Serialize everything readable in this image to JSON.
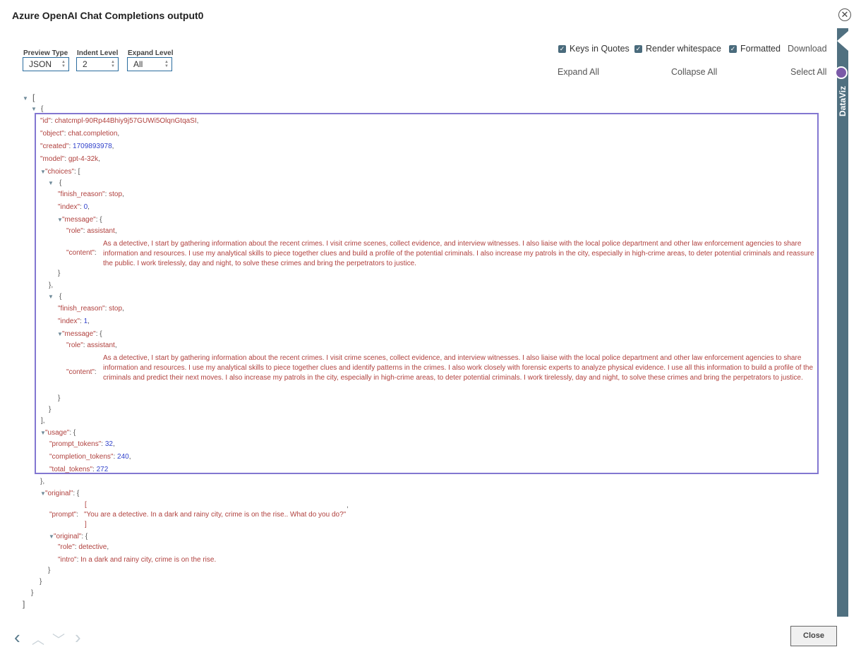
{
  "window": {
    "title": "Azure OpenAI Chat Completions output0",
    "close_label": "Close"
  },
  "controls": {
    "preview_type": {
      "label": "Preview Type",
      "value": "JSON"
    },
    "indent_level": {
      "label": "Indent Level",
      "value": "2"
    },
    "expand_level": {
      "label": "Expand Level",
      "value": "All"
    },
    "keys_in_quotes": {
      "label": "Keys in Quotes",
      "checked": true
    },
    "render_whitespace": {
      "label": "Render whitespace",
      "checked": true
    },
    "formatted": {
      "label": "Formatted",
      "checked": true
    },
    "download": "Download",
    "expand_all": "Expand All",
    "collapse_all": "Collapse All",
    "select_all": "Select All"
  },
  "sidebar": {
    "label": "DataViz"
  },
  "json": {
    "id_key": "\"id\"",
    "id_val": "chatcmpl-90Rp44Bhiy9j57GUWi5OlqnGtqaSI",
    "object_key": "\"object\"",
    "object_val": "chat.completion",
    "created_key": "\"created\"",
    "created_val": "1709893978",
    "model_key": "\"model\"",
    "model_val": "gpt-4-32k",
    "choices_key": "\"choices\"",
    "finish_key": "\"finish_reason\"",
    "finish_val": "stop",
    "index_key": "\"index\"",
    "index0": "0",
    "index1": "1",
    "message_key": "\"message\"",
    "role_key": "\"role\"",
    "role_val": "assistant",
    "content_key": "\"content\"",
    "content0": "As a detective, I start by gathering information about the recent crimes. I visit crime scenes, collect evidence, and interview witnesses. I also liaise with the local police department and other law enforcement agencies to share information and resources. I use my analytical skills to piece together clues and build a profile of the potential criminals. I also increase my patrols in the city, especially in high-crime areas, to deter potential criminals and reassure the public. I work tirelessly, day and night, to solve these crimes and bring the perpetrators to justice.",
    "content1": "As a detective, I start by gathering information about the recent crimes. I visit crime scenes, collect evidence, and interview witnesses. I also liaise with the local police department and other law enforcement agencies to share information and resources. I use my analytical skills to piece together clues and identify patterns in the crimes. I also work closely with forensic experts to analyze physical evidence. I use all this information to build a profile of the criminals and predict their next moves. I also increase my patrols in the city, especially in high-crime areas, to deter potential criminals. I work tirelessly, day and night, to solve these crimes and bring the perpetrators to justice.",
    "usage_key": "\"usage\"",
    "prompt_tokens_key": "\"prompt_tokens\"",
    "prompt_tokens_val": "32",
    "completion_tokens_key": "\"completion_tokens\"",
    "completion_tokens_val": "240",
    "total_tokens_key": "\"total_tokens\"",
    "total_tokens_val": "272",
    "original_key": "\"original\"",
    "prompt_key": "\"prompt\"",
    "prompt_val": "\"You are a detective. In a dark and rainy city, crime is on the rise.. What do you do?\"",
    "role2_val": "detective",
    "intro_key": "\"intro\"",
    "intro_val": "In a dark and rainy city, crime is on the rise."
  }
}
